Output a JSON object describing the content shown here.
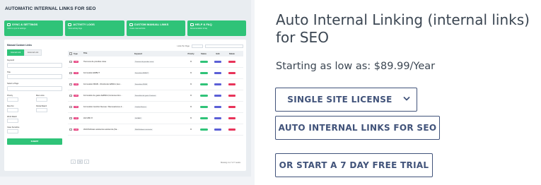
{
  "thumbnail": {
    "title": "AUTOMATIC INTERNAL LINKS FOR SEO",
    "cards": [
      {
        "title": "SYNC & SETTINGS",
        "sub": "Click to sync & settings"
      },
      {
        "title": "ACTIVITY LOGS",
        "sub": "View activity logs"
      },
      {
        "title": "CUSTOM MANUAL LINKS",
        "sub": "Create manual links"
      },
      {
        "title": "HELP & FAQ",
        "sub": "Documentation & faq"
      }
    ],
    "left_panel": {
      "title": "Manual Custom Links",
      "tabs": [
        "Internal Link",
        "External Link"
      ],
      "fields": [
        "Keyword",
        "Title",
        "Select a Page",
        "Priority",
        "Max Links",
        "Max Per",
        "Word Match",
        "Partial Match",
        "Case Sensitive"
      ],
      "submit_label": "SUBMIT"
    },
    "table": {
      "per_page_label": "Links Per Page",
      "per_page_value": "All",
      "search_placeholder": "search",
      "headers": [
        "Type",
        "Title",
        "Keyword",
        "Priority",
        "Status",
        "Edit",
        "Delete"
      ],
      "rows": [
        {
          "type": "LINK",
          "title": "Tienoxos de prendas coisa",
          "keyword": "Tienoxos de prendas coisa",
          "priority": "0"
        },
        {
          "type": "LINK",
          "title": "Formulário EMBUT",
          "keyword": "Formulário EMBUT",
          "priority": "0"
        },
        {
          "type": "LINK",
          "title": "Formulário PESB - Obrobrodo &#8211; Esc...",
          "keyword": "Formulário PESB",
          "priority": "0"
        },
        {
          "type": "LINK",
          "title": "Formulário de gasto dá#8211;Contenes Zen...",
          "keyword": "Formulário de gasto Contenes",
          "priority": "0"
        },
        {
          "type": "LINK",
          "title": "Formulário Cambio Nuevas / Renovaciones d...",
          "keyword": "Cambio Nuevas",
          "priority": "0"
        },
        {
          "type": "LINK",
          "title": "Zell ABC 8",
          "keyword": "Zell ABC",
          "priority": "0"
        },
        {
          "type": "LINK",
          "title": "Web/Software asistentes asistencia (Sa...",
          "keyword": "Web/Software asistentes",
          "priority": "0"
        }
      ],
      "pager": [
        "«",
        "1",
        "»"
      ],
      "showing": "Showing 1 to 7 of 7 results"
    }
  },
  "product": {
    "title": "Auto Internal Linking (internal links) for SEO",
    "price": "Starting as low as: $89.99/Year",
    "license_select": "SINGLE SITE LICENSE",
    "addon_button": "AUTO INTERNAL LINKS FOR SEO",
    "trial_button": "OR START A 7 DAY FREE TRIAL",
    "colors": {
      "button_border": "#41537a",
      "accent_green": "#2fc378"
    }
  }
}
